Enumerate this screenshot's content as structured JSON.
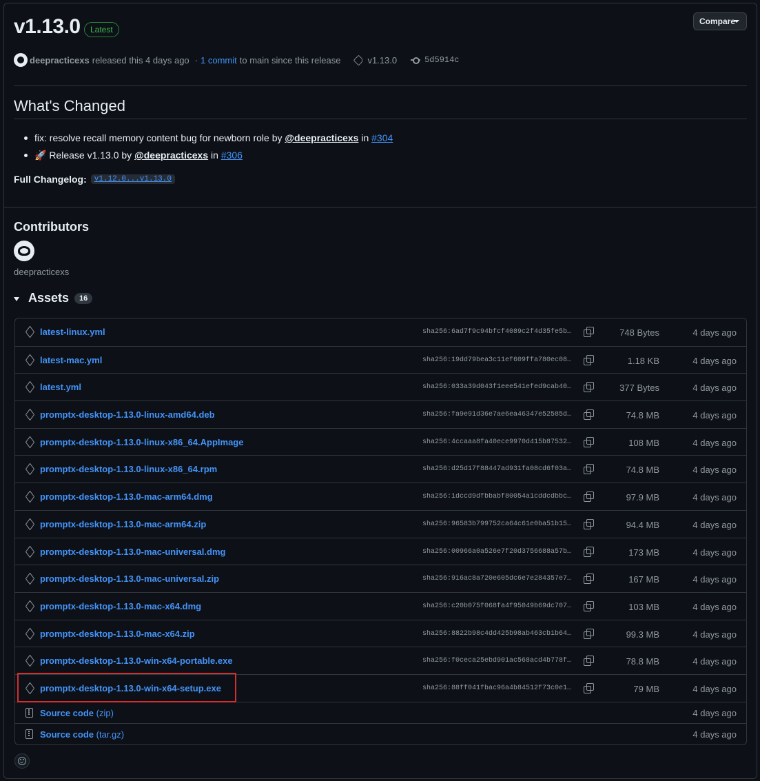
{
  "release": {
    "version": "v1.13.0",
    "badge": "Latest",
    "compare_label": "Compare",
    "author": "deepracticexs",
    "released_text": "released this 4 days ago",
    "commit_link": "1 commit",
    "commit_suffix": "to main since this release",
    "tag": "v1.13.0",
    "commit_hash": "5d5914c"
  },
  "changes": {
    "heading": "What's Changed",
    "items": [
      {
        "prefix": "fix: resolve recall memory content bug for newborn role by ",
        "user": "@deepracticexs",
        "mid": " in ",
        "pr": "#304"
      },
      {
        "prefix": "🚀 Release v1.13.0 by ",
        "user": "@deepracticexs",
        "mid": " in ",
        "pr": "#306"
      }
    ],
    "changelog_label": "Full Changelog:",
    "changelog_link": "v1.12.0...v1.13.0"
  },
  "contributors": {
    "heading": "Contributors",
    "names": [
      "deepracticexs"
    ]
  },
  "assets": {
    "heading": "Assets",
    "count": "16",
    "items": [
      {
        "name": "latest-linux.yml",
        "sha": "sha256:6ad7f9c94bfcf4089c2f4d35fe5b2…",
        "size": "748 Bytes",
        "date": "4 days ago"
      },
      {
        "name": "latest-mac.yml",
        "sha": "sha256:19dd79bea3c11ef609ffa780ec084…",
        "size": "1.18 KB",
        "date": "4 days ago"
      },
      {
        "name": "latest.yml",
        "sha": "sha256:033a39d043f1eee541efed9cab401…",
        "size": "377 Bytes",
        "date": "4 days ago"
      },
      {
        "name": "promptx-desktop-1.13.0-linux-amd64.deb",
        "sha": "sha256:fa9e91d36e7ae6ea46347e52585dc…",
        "size": "74.8 MB",
        "date": "4 days ago"
      },
      {
        "name": "promptx-desktop-1.13.0-linux-x86_64.AppImage",
        "sha": "sha256:4ccaaa8fa40ece9970d415b875324…",
        "size": "108 MB",
        "date": "4 days ago"
      },
      {
        "name": "promptx-desktop-1.13.0-linux-x86_64.rpm",
        "sha": "sha256:d25d17f88447ad931fa08cd6f03af…",
        "size": "74.8 MB",
        "date": "4 days ago"
      },
      {
        "name": "promptx-desktop-1.13.0-mac-arm64.dmg",
        "sha": "sha256:1dccd9dfbbabf80054a1cddcdbbc8…",
        "size": "97.9 MB",
        "date": "4 days ago"
      },
      {
        "name": "promptx-desktop-1.13.0-mac-arm64.zip",
        "sha": "sha256:96583b799752ca64c61e0ba51b15b…",
        "size": "94.4 MB",
        "date": "4 days ago"
      },
      {
        "name": "promptx-desktop-1.13.0-mac-universal.dmg",
        "sha": "sha256:00966a0a526e7f20d3756688a57b1…",
        "size": "173 MB",
        "date": "4 days ago"
      },
      {
        "name": "promptx-desktop-1.13.0-mac-universal.zip",
        "sha": "sha256:916ac8a720e605dc6e7e284357e7f…",
        "size": "167 MB",
        "date": "4 days ago"
      },
      {
        "name": "promptx-desktop-1.13.0-mac-x64.dmg",
        "sha": "sha256:c20b075f068fa4f95049b69dc707d…",
        "size": "103 MB",
        "date": "4 days ago"
      },
      {
        "name": "promptx-desktop-1.13.0-mac-x64.zip",
        "sha": "sha256:8822b98c4dd425b98ab463cb1b649…",
        "size": "99.3 MB",
        "date": "4 days ago"
      },
      {
        "name": "promptx-desktop-1.13.0-win-x64-portable.exe",
        "sha": "sha256:f0ceca25ebd901ac568acd4b778f7…",
        "size": "78.8 MB",
        "date": "4 days ago"
      },
      {
        "name": "promptx-desktop-1.13.0-win-x64-setup.exe",
        "sha": "sha256:88ff041fbac96a4b84512f73c0e1b…",
        "size": "79 MB",
        "date": "4 days ago"
      }
    ],
    "sources": [
      {
        "label": "Source code",
        "format": "(zip)",
        "date": "4 days ago"
      },
      {
        "label": "Source code",
        "format": "(tar.gz)",
        "date": "4 days ago"
      }
    ]
  },
  "colors": {
    "background": "#0d1117",
    "link": "#4493f8",
    "latest_badge": "#3fb950",
    "highlight_box": "#d32f2f"
  }
}
